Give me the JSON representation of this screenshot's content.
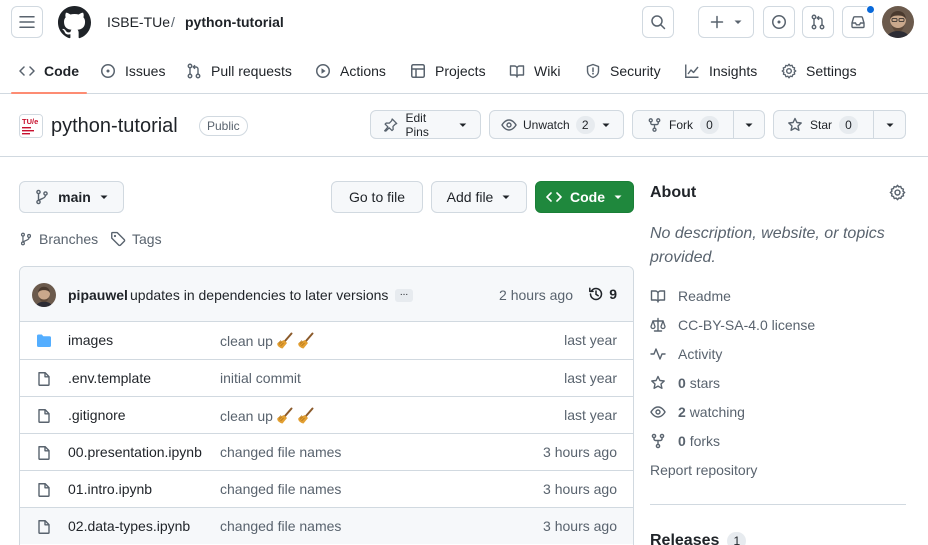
{
  "header": {
    "owner": "ISBE-TUe",
    "separator": "/",
    "repo": "python-tutorial"
  },
  "nav": {
    "items": [
      {
        "label": "Code"
      },
      {
        "label": "Issues"
      },
      {
        "label": "Pull requests"
      },
      {
        "label": "Actions"
      },
      {
        "label": "Projects"
      },
      {
        "label": "Wiki"
      },
      {
        "label": "Security"
      },
      {
        "label": "Insights"
      },
      {
        "label": "Settings"
      }
    ]
  },
  "repo_header": {
    "org_logo_text": "TU/e",
    "title": "python-tutorial",
    "visibility": "Public",
    "edit_pins_label": "Edit Pins",
    "unwatch_label": "Unwatch",
    "unwatch_count": "2",
    "fork_label": "Fork",
    "fork_count": "0",
    "star_label": "Star",
    "star_count": "0"
  },
  "toolbar": {
    "branch": "main",
    "go_to_file": "Go to file",
    "add_file": "Add file",
    "code": "Code",
    "branches_label": "Branches",
    "tags_label": "Tags"
  },
  "commit": {
    "author": "pipauwel",
    "message": "updates in dependencies to later versions",
    "ellipsis": "...",
    "time": "2 hours ago",
    "count": "9"
  },
  "files": [
    {
      "name": "images",
      "type": "folder",
      "message": "clean up",
      "emoji": true,
      "time": "last year"
    },
    {
      "name": ".env.template",
      "type": "file",
      "message": "initial commit",
      "emoji": false,
      "time": "last year"
    },
    {
      "name": ".gitignore",
      "type": "file",
      "message": "clean up",
      "emoji": true,
      "time": "last year"
    },
    {
      "name": "00.presentation.ipynb",
      "type": "file",
      "message": "changed file names",
      "emoji": false,
      "time": "3 hours ago"
    },
    {
      "name": "01.intro.ipynb",
      "type": "file",
      "message": "changed file names",
      "emoji": false,
      "time": "3 hours ago"
    },
    {
      "name": "02.data-types.ipynb",
      "type": "file",
      "message": "changed file names",
      "emoji": false,
      "time": "3 hours ago"
    }
  ],
  "about": {
    "title": "About",
    "description": "No description, website, or topics provided.",
    "readme": "Readme",
    "license": "CC-BY-SA-4.0 license",
    "activity": "Activity",
    "stars_count": "0",
    "stars_label": "stars",
    "watching_count": "2",
    "watching_label": "watching",
    "forks_count": "0",
    "forks_label": "forks",
    "report": "Report repository"
  },
  "releases": {
    "title": "Releases",
    "count": "1"
  },
  "colors": {
    "accent_green": "#1f883d",
    "nav_underline": "#fd8c73",
    "folder_blue": "#54aeff",
    "notification_blue": "#0969da"
  }
}
